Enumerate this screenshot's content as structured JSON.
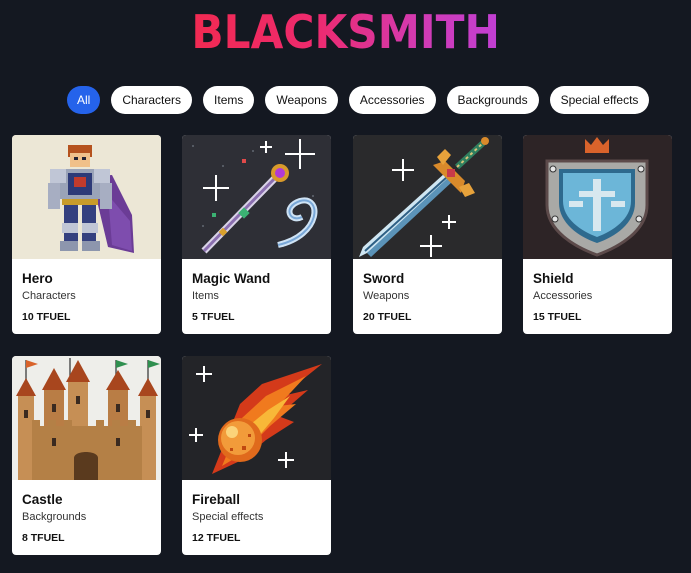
{
  "logo": {
    "text": "BLACKSMITH"
  },
  "filters": [
    {
      "label": "All",
      "active": true
    },
    {
      "label": "Characters",
      "active": false
    },
    {
      "label": "Items",
      "active": false
    },
    {
      "label": "Weapons",
      "active": false
    },
    {
      "label": "Accessories",
      "active": false
    },
    {
      "label": "Backgrounds",
      "active": false
    },
    {
      "label": "Special effects",
      "active": false
    }
  ],
  "products": [
    {
      "name": "Hero",
      "category": "Characters",
      "price": "10 TFUEL",
      "image_icon": "armored-hero-icon"
    },
    {
      "name": "Magic Wand",
      "category": "Items",
      "price": "5 TFUEL",
      "image_icon": "magic-wand-icon"
    },
    {
      "name": "Sword",
      "category": "Weapons",
      "price": "20 TFUEL",
      "image_icon": "sword-icon"
    },
    {
      "name": "Shield",
      "category": "Accessories",
      "price": "15 TFUEL",
      "image_icon": "shield-icon"
    },
    {
      "name": "Castle",
      "category": "Backgrounds",
      "price": "8 TFUEL",
      "image_icon": "castle-icon"
    },
    {
      "name": "Fireball",
      "category": "Special effects",
      "price": "12 TFUEL",
      "image_icon": "fireball-icon"
    }
  ],
  "colors": {
    "background": "#141821",
    "accent": "#2563eb",
    "logo_gradient_start": "#f12a52",
    "logo_gradient_end": "#c13fd4"
  }
}
